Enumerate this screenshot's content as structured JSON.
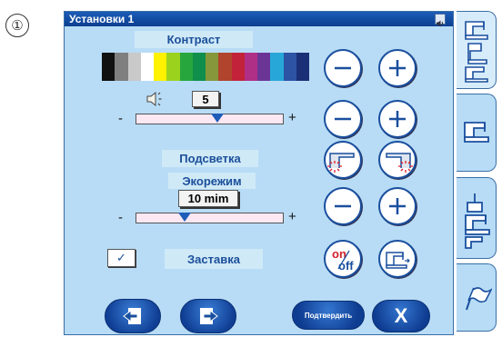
{
  "step_marker": "①",
  "window": {
    "title": "Установки 1",
    "speaker_icon": "speaker-small-icon"
  },
  "contrast": {
    "label": "Контраст",
    "swatches": [
      "#111111",
      "#7f7f7f",
      "#c9c9c9",
      "#ffffff",
      "#fff200",
      "#9bd21e",
      "#27a63d",
      "#0f8f4b",
      "#85973a",
      "#b0442c",
      "#c3233a",
      "#b02f86",
      "#6b3596",
      "#27a7d8",
      "#2d53a5",
      "#1b2f76"
    ]
  },
  "volume": {
    "icon": "speaker-icon",
    "value": "5",
    "slider_fraction": 0.55
  },
  "backlight": {
    "label": "Подсветка"
  },
  "eco": {
    "label": "Экорежим",
    "value": "10 mim",
    "slider_fraction": 0.33
  },
  "screensaver": {
    "check": "✓",
    "label": "Заставка"
  },
  "sliders": {
    "minus": "-",
    "plus": "+"
  },
  "buttons": {
    "on": "on",
    "off": "off",
    "confirm": "Подтвердить",
    "cancel": "X"
  },
  "colors": {
    "accent": "#0e3c91",
    "panel": "#b8dcf6",
    "label_text": "#1b4f9a"
  }
}
